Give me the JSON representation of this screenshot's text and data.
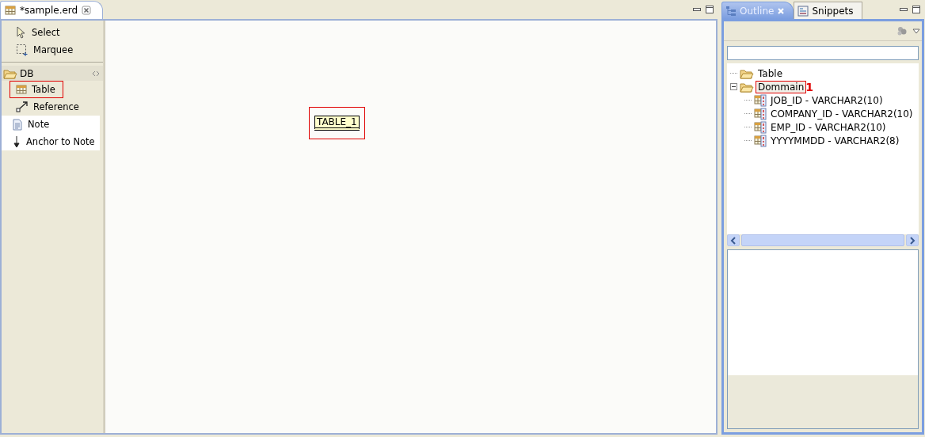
{
  "editor": {
    "tab": {
      "title": "*sample.erd",
      "selected": true
    }
  },
  "palette": {
    "tools": [
      {
        "label": "Select",
        "kind": "select"
      },
      {
        "label": "Marquee",
        "kind": "marquee"
      }
    ],
    "drawer": {
      "label": "DB",
      "expanded": true
    },
    "items": [
      {
        "label": "Table",
        "kind": "table",
        "highlighted": true
      },
      {
        "label": "Reference",
        "kind": "reference",
        "highlighted": false
      },
      {
        "label": "Note",
        "kind": "note",
        "highlighted": false
      },
      {
        "label": "Anchor to Note",
        "kind": "anchor",
        "highlighted": false
      }
    ]
  },
  "canvas": {
    "nodes": [
      {
        "label": "TABLE_1",
        "highlighted": true
      }
    ]
  },
  "views": {
    "tabs": [
      {
        "label": "Outline",
        "selected": true,
        "kind": "outline"
      },
      {
        "label": "Snippets",
        "selected": false,
        "kind": "snippets"
      }
    ]
  },
  "outline": {
    "tree": [
      {
        "label": "Table",
        "kind": "folder",
        "highlighted": false
      },
      {
        "label": "Dommain",
        "kind": "folder",
        "expanded": true,
        "highlighted": true,
        "annotation": "1",
        "children": [
          {
            "label": "JOB_ID - VARCHAR2(10)",
            "kind": "column"
          },
          {
            "label": "COMPANY_ID - VARCHAR2(10)",
            "kind": "column"
          },
          {
            "label": "EMP_ID - VARCHAR2(10)",
            "kind": "column"
          },
          {
            "label": "YYYYMMDD - VARCHAR2(8)",
            "kind": "column"
          }
        ]
      }
    ]
  }
}
